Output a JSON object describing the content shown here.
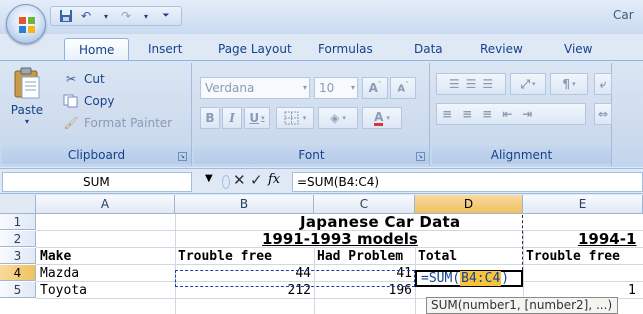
{
  "titlebar": {
    "title_partial": "Car"
  },
  "quick_access": {
    "save_icon": "save-icon",
    "undo_icon": "undo-icon",
    "redo_icon": "redo-icon",
    "customize_icon": "customize-icon"
  },
  "tabs": [
    {
      "label": "Home",
      "active": true
    },
    {
      "label": "Insert"
    },
    {
      "label": "Page Layout"
    },
    {
      "label": "Formulas"
    },
    {
      "label": "Data"
    },
    {
      "label": "Review"
    },
    {
      "label": "View"
    }
  ],
  "ribbon": {
    "clipboard": {
      "label": "Clipboard",
      "paste": "Paste",
      "cut": "Cut",
      "copy": "Copy",
      "format_painter": "Format Painter"
    },
    "font": {
      "label": "Font",
      "font_name": "Verdana",
      "font_size": "10",
      "bold": "B",
      "italic": "I",
      "underline": "U"
    },
    "alignment": {
      "label": "Alignment"
    }
  },
  "formula_bar": {
    "name_box": "SUM",
    "formula": "=SUM(B4:C4)",
    "fx": "fx"
  },
  "columns": [
    "A",
    "B",
    "C",
    "D",
    "E"
  ],
  "rows": [
    "1",
    "2",
    "3",
    "4",
    "5"
  ],
  "cells": {
    "title": "Japanese Car Data",
    "models_1991": "1991-1993 models",
    "models_1994": "1994-1",
    "a3": "Make",
    "b3": "Trouble free",
    "c3": "Had Problem",
    "d3": "Total",
    "e3": "Trouble free",
    "a4": "Mazda",
    "b4": "44",
    "c4": "41",
    "a5": "Toyota",
    "b5": "212",
    "c5": "196",
    "f5": "1"
  },
  "active_cell": {
    "prefix": "=SUM(",
    "ref": "B4:C4",
    "suffix": ")"
  },
  "tooltip": {
    "text": "SUM(number1, [number2], ...)"
  },
  "colors": {
    "selection_orange": "#f1c15f",
    "marquee_blue": "#1a3fb0",
    "ref_highlight": "#f7c23d"
  }
}
